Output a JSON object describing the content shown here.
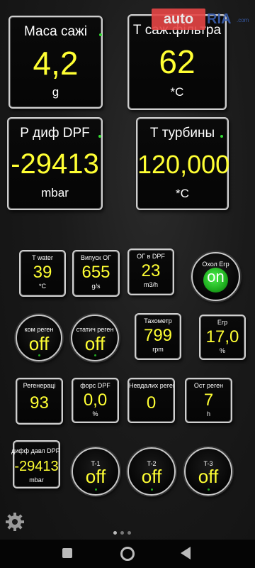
{
  "gauges_large": [
    {
      "label": "Маса сажі",
      "value": "4,2",
      "unit": "g"
    },
    {
      "label": "Т саж.фільтра",
      "value": "62",
      "unit": "*C"
    },
    {
      "label": "Р диф DPF",
      "value": "-29413",
      "unit": "mbar"
    },
    {
      "label": "Т турбины",
      "value": "120,000",
      "unit": "*C"
    }
  ],
  "gauges_small": [
    {
      "label": "T water",
      "value": "39",
      "unit": "*C"
    },
    {
      "label": "Випуск ОГ",
      "value": "655",
      "unit": "g/s"
    },
    {
      "label": "ОГ в DPF",
      "value": "23",
      "unit": "m3/h"
    },
    {
      "label": "Тахометр",
      "value": "799",
      "unit": "rpm"
    },
    {
      "label": "Егр",
      "value": "17,0",
      "unit": "%"
    },
    {
      "label": "Регенераці",
      "value": "93",
      "unit": ""
    },
    {
      "label": "форс DPF",
      "value": "0,0",
      "unit": "%"
    },
    {
      "label": "Невдалих реген",
      "value": "0",
      "unit": ""
    },
    {
      "label": "Ост реген",
      "value": "7",
      "unit": "h"
    },
    {
      "label": "дифф давл DPF",
      "value": "-29413",
      "unit": "mbar"
    }
  ],
  "toggles": [
    {
      "label": "Охол Егр",
      "value": "on",
      "active": true
    },
    {
      "label": "ком реген",
      "value": "off",
      "active": false
    },
    {
      "label": "статич реген",
      "value": "off",
      "active": false
    },
    {
      "label": "T-1",
      "value": "off",
      "active": false
    },
    {
      "label": "T-2",
      "value": "off",
      "active": false
    },
    {
      "label": "T-3",
      "value": "off",
      "active": false
    }
  ],
  "watermark": {
    "brand": "auto",
    "brand2": "RIA",
    "suffix": ".com"
  },
  "icons": {
    "settings": "gear-icon",
    "back": "square-recents-icon",
    "home": "circle-home-icon",
    "back_arrow": "triangle-back-icon"
  },
  "colors": {
    "value": "#ffff33",
    "on_toggle": "#33cc33",
    "border": "#cfcfcf"
  }
}
